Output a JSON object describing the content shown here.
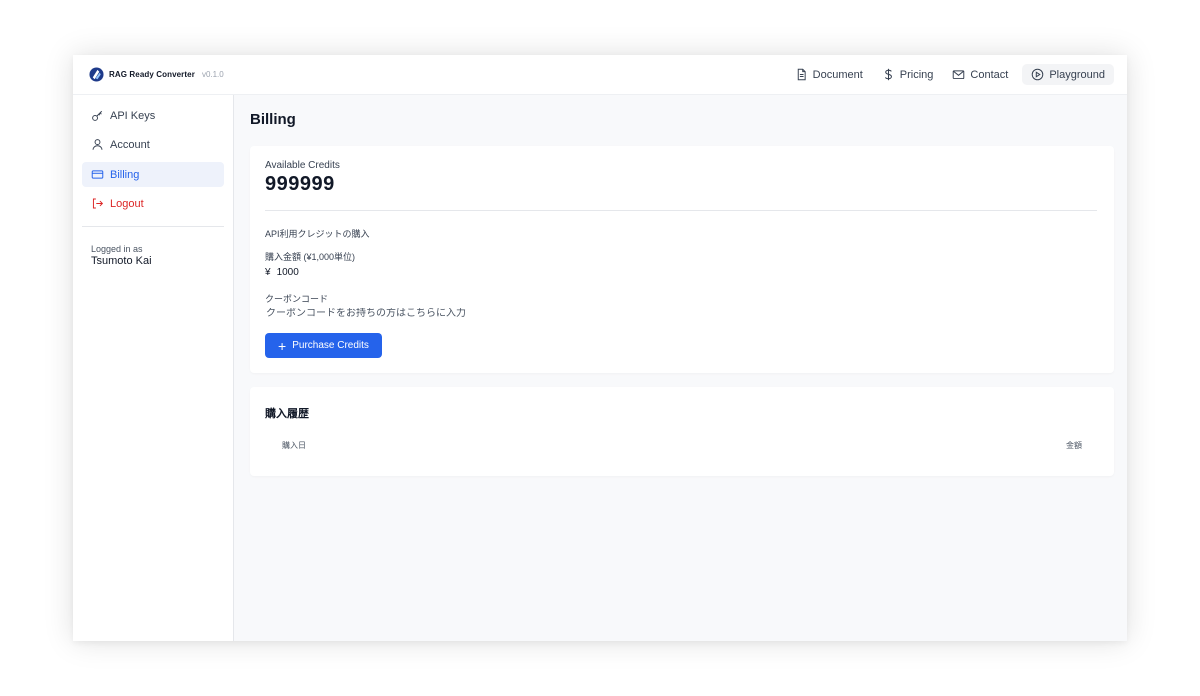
{
  "header": {
    "brand_name": "RAG Ready Converter",
    "version": "v0.1.0",
    "nav": [
      {
        "label": "Document",
        "icon": "document-icon"
      },
      {
        "label": "Pricing",
        "icon": "dollar-icon"
      },
      {
        "label": "Contact",
        "icon": "mail-icon"
      },
      {
        "label": "Playground",
        "icon": "play-circle-icon"
      }
    ]
  },
  "sidebar": {
    "items": [
      {
        "label": "API Keys",
        "icon": "key-icon"
      },
      {
        "label": "Account",
        "icon": "user-icon"
      },
      {
        "label": "Billing",
        "icon": "credit-card-icon",
        "active": true
      },
      {
        "label": "Logout",
        "icon": "logout-icon"
      }
    ],
    "logged_in_label": "Logged in as",
    "user_name": "Tsumoto Kai"
  },
  "main": {
    "title": "Billing",
    "credits": {
      "label": "Available Credits",
      "value": "999999"
    },
    "purchase": {
      "section_title": "API利用クレジットの購入",
      "amount_label": "購入金額 (¥1,000単位)",
      "currency_symbol": "¥",
      "amount_value": "1000",
      "coupon_label": "クーポンコード",
      "coupon_placeholder": "クーポンコードをお持ちの方はこちらに入力",
      "button_label": "Purchase Credits"
    },
    "history": {
      "title": "購入履歴",
      "columns": [
        "購入日",
        "金額"
      ],
      "rows": []
    }
  },
  "colors": {
    "accent": "#2563eb",
    "logout": "#dc2626",
    "active_bg": "#eef2fb"
  }
}
